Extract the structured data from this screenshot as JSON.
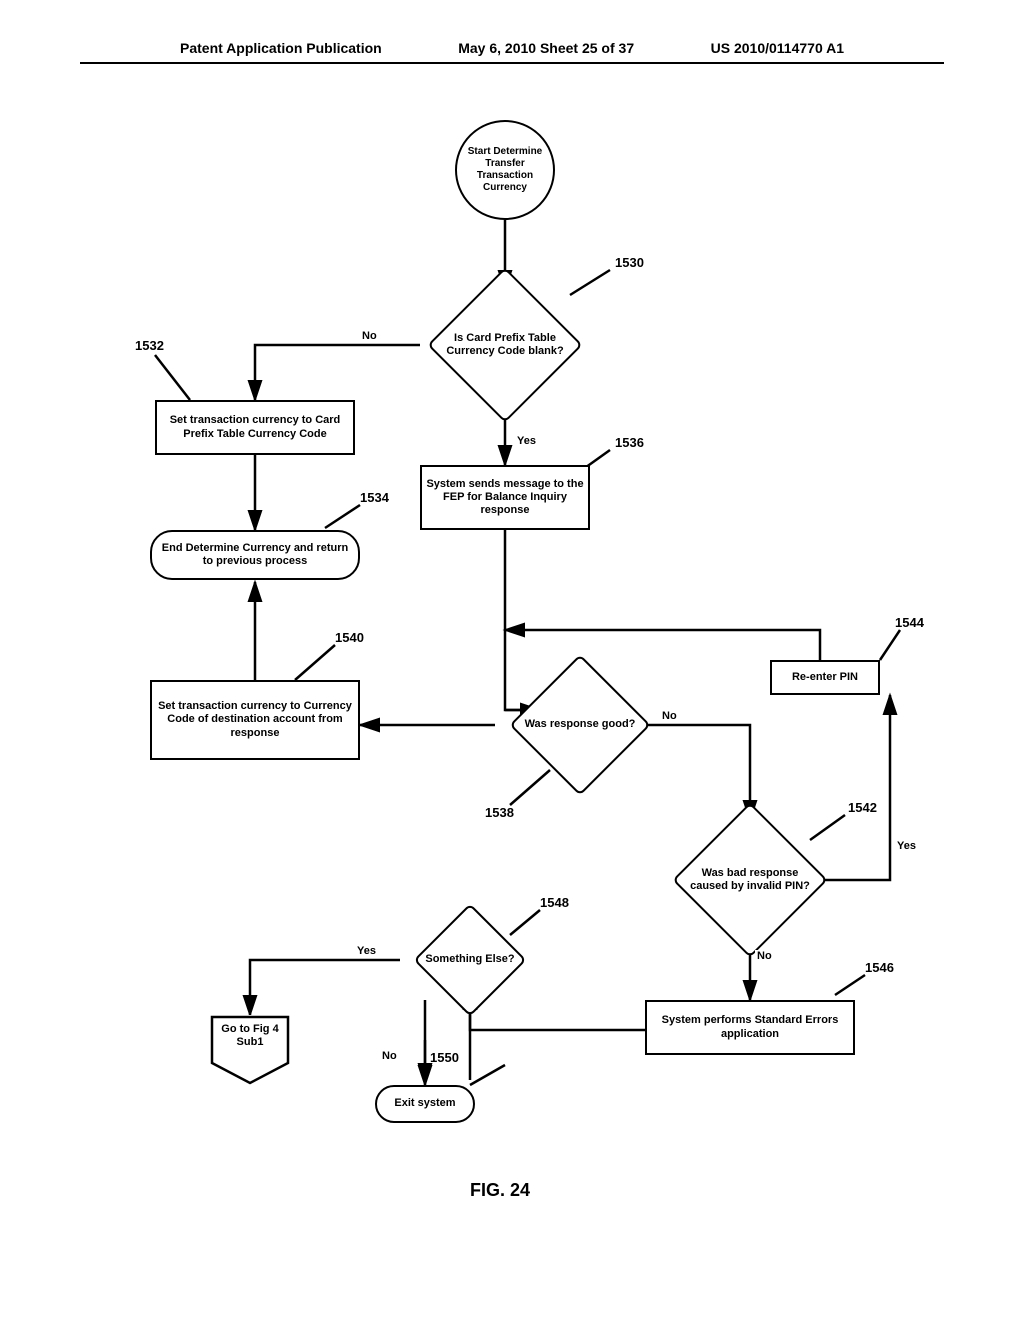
{
  "header": {
    "left": "Patent Application Publication",
    "center": "May 6, 2010  Sheet 25 of 37",
    "right": "US 2010/0114770 A1"
  },
  "nodes": {
    "start": "Start Determine Transfer Transaction Currency",
    "d1530": "Is Card Prefix Table Currency Code blank?",
    "p1532": "Set transaction currency to Card Prefix Table Currency Code",
    "t1534": "End Determine Currency and return to previous process",
    "p1536": "System sends message to the FEP for Balance Inquiry response",
    "d1538": "Was response good?",
    "p1540": "Set transaction currency to Currency Code of destination account from response",
    "d1542": "Was bad response caused by invalid PIN?",
    "p1544": "Re-enter PIN",
    "p1546": "System performs Standard Errors application",
    "d1548": "Something Else?",
    "t1550": "Exit system",
    "offpage": "Go to Fig 4 Sub1"
  },
  "refs": {
    "r1530": "1530",
    "r1532": "1532",
    "r1534": "1534",
    "r1536": "1536",
    "r1538": "1538",
    "r1540": "1540",
    "r1542": "1542",
    "r1544": "1544",
    "r1546": "1546",
    "r1548": "1548",
    "r1550": "1550"
  },
  "labels": {
    "yes": "Yes",
    "no": "No"
  },
  "figure": "FIG. 24"
}
